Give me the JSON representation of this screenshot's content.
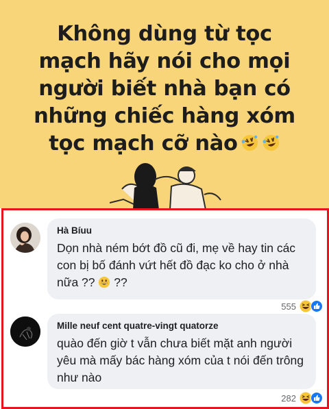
{
  "banner": {
    "title_lines": [
      "Không dùng từ tọc",
      "mạch hãy nói cho mọi",
      "người biết nhà bạn có",
      "những chiếc hàng xóm",
      "tọc mạch cỡ nào"
    ],
    "emoji": "rolling-on-floor-laughing"
  },
  "comments": [
    {
      "author": "Hà Bíuu",
      "text": "Dọn nhà ném bớt đồ cũ đi, mẹ về hay tin các con bị bố đánh vứt hết đồ đạc ko cho ở nhà nữa ??",
      "text_suffix": "??",
      "inline_emoji": "grinning-face",
      "reaction_count": "555",
      "reactions": [
        "haha",
        "like"
      ]
    },
    {
      "author": "Mille neuf cent quatre-vingt quatorze",
      "text": "quào đến giờ t vẫn chưa biết mặt anh người yêu mà mấy bác hàng xóm của t nói đến trông như nào",
      "reaction_count": "282",
      "reactions": [
        "haha",
        "like"
      ]
    }
  ],
  "colors": {
    "banner_bg": "#f9d57a",
    "highlight_border": "#e5141e",
    "bubble_bg": "#eef0f3",
    "like_blue": "#1877f2",
    "haha_yellow": "#f7c53a"
  }
}
